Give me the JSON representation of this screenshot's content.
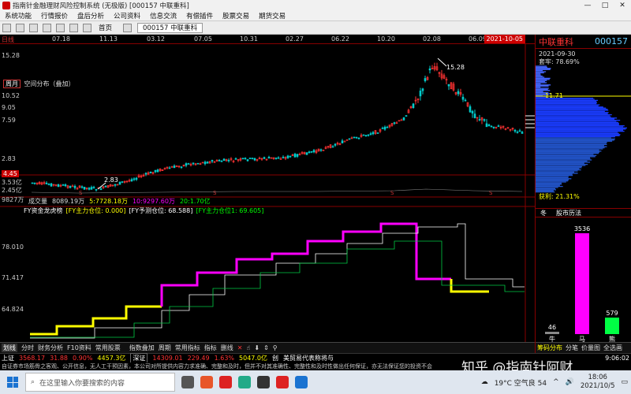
{
  "window": {
    "title": "指南针金融理财风险控制系统 (无极版)  [000157 中联重科]",
    "controls": [
      "—",
      "□",
      "✕"
    ]
  },
  "menu": [
    "系统功能",
    "行情报价",
    "盘后分析",
    "公司资料",
    "信息交流",
    "有偿插件",
    "股票交易",
    "期货交易"
  ],
  "toolbar": {
    "home_label": "首页",
    "tab_label": "000157 中联重科"
  },
  "time_axis": {
    "period_label": "日线",
    "dates": [
      "07.18",
      "11.13",
      "03.12",
      "07.05",
      "10.31",
      "02.27",
      "06.22",
      "10.20",
      "02.08",
      "06.09"
    ],
    "current_date": "2021-10-05"
  },
  "price_panel": {
    "period_box": "周月",
    "mode_label": "空间分布（叠加）",
    "y_ticks": [
      "15.28",
      "12.76",
      "10.52",
      "9.05",
      "7.59",
      "6.14",
      "2.83"
    ],
    "current_price": "4.45",
    "low_annot": "2.83",
    "high_annot": "15.28",
    "extra_ticks": [
      "3.53亿",
      "2.45亿",
      "9827万"
    ]
  },
  "volume_panel": {
    "label": "成交量",
    "value": "8089.19万",
    "ma5": "5:7728.18万",
    "ma10": "10:9297.60万",
    "ma20": "20:1.70亿"
  },
  "indicator_panel": {
    "name": "FY资金龙虎榜",
    "v1": "[FY主力仓位: 0.000]",
    "v2": "[FY予测仓位: 68.588]",
    "v3": "[FY主力仓位1: 69.605]",
    "y_ticks": [
      "78.010",
      "71.417",
      "64.824"
    ]
  },
  "right_panel": {
    "stock_name": "中联重科",
    "stock_code": "000157",
    "date": "2021-09-30",
    "ratio_label": "套牢: 78.69%",
    "price_marker": "11.71",
    "profit_label": "获利: 21.31%",
    "hist_title_left": "冬",
    "hist_title": "股市历法",
    "bars": [
      {
        "label": "牛",
        "value": 46
      },
      {
        "label": "马",
        "value": 3536
      },
      {
        "label": "熊",
        "value": 579
      }
    ],
    "tabs": [
      "筹码分布",
      "分笔",
      "价量图",
      "全选画"
    ]
  },
  "bottom_tabs": [
    "划线",
    "分时",
    "财务分析",
    "F10资料",
    "常用股票",
    "指数叠加",
    "周期",
    "常用指标",
    "指标",
    "删线"
  ],
  "index_bar": {
    "sh_label": "上证",
    "sh_value": "3568.17",
    "sh_change": "31.88",
    "sh_pct": "0.90%",
    "sh_amount": "4457.3亿",
    "sz_label": "深证",
    "sz_value": "14309.01",
    "sz_change": "229.49",
    "sz_pct": "1.63%",
    "sz_amount": "5047.0亿",
    "news_tag": "创",
    "news_text": "美贸易代表称将与",
    "time": "9:06:02"
  },
  "disclaimer": "自证券市场筋骨之客观、公开信息，无人工干预因素，本公司对所提供内容力求准确、完整和及时，但并不对其准确性、完整性和及时性做出任何保证，亦无法保证您的投资不会",
  "watermark": "知乎 @指南针阿财",
  "taskbar": {
    "search_placeholder": "在这里输入你要搜索的内容",
    "weather": "19°C 空气良 54",
    "time": "18:06",
    "date": "2021/10/5"
  },
  "colors": {
    "up": "#ff3333",
    "down": "#00cccc",
    "magenta": "#ff00ff",
    "yellow": "#ffff00",
    "accent_blue": "#1a73d1"
  }
}
